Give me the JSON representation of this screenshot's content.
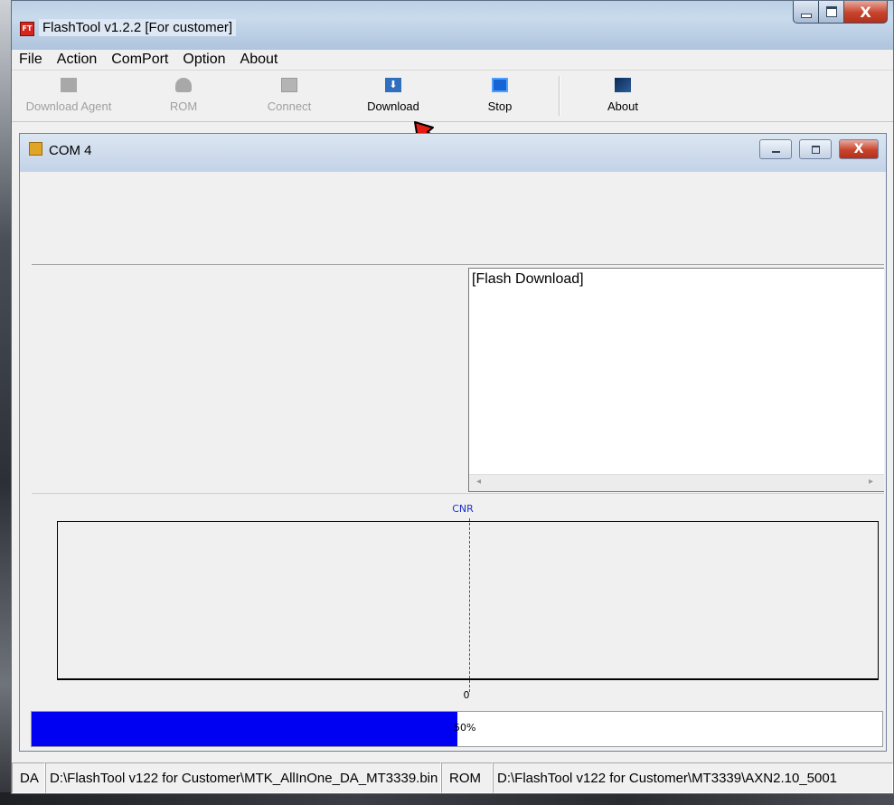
{
  "window": {
    "title": "FlashTool v1.2.2 [For customer]",
    "icon_text": "FT",
    "close_glyph": "X"
  },
  "menu": [
    "File",
    "Action",
    "ComPort",
    "Option",
    "About"
  ],
  "toolbar": {
    "download_agent": "Download Agent",
    "rom": "ROM",
    "connect": "Connect",
    "download": "Download",
    "stop": "Stop",
    "about": "About"
  },
  "child_window": {
    "title": "COM 4",
    "close_glyph": "X"
  },
  "log": {
    "text": "[Flash Download]",
    "scroll_left": "◂",
    "scroll_right": "▸"
  },
  "chart": {
    "label": "CNR",
    "zero_label": "0"
  },
  "progress": {
    "value": 0.5,
    "text": "50%",
    "fill_color": "#0000f2"
  },
  "status": {
    "da_label": "DA",
    "da_path": "D:\\FlashTool v122 for Customer\\MTK_AllInOne_DA_MT3339.bin",
    "rom_label": "ROM",
    "rom_path": "D:\\FlashTool v122 for Customer\\MT3339\\AXN2.10_5001"
  }
}
